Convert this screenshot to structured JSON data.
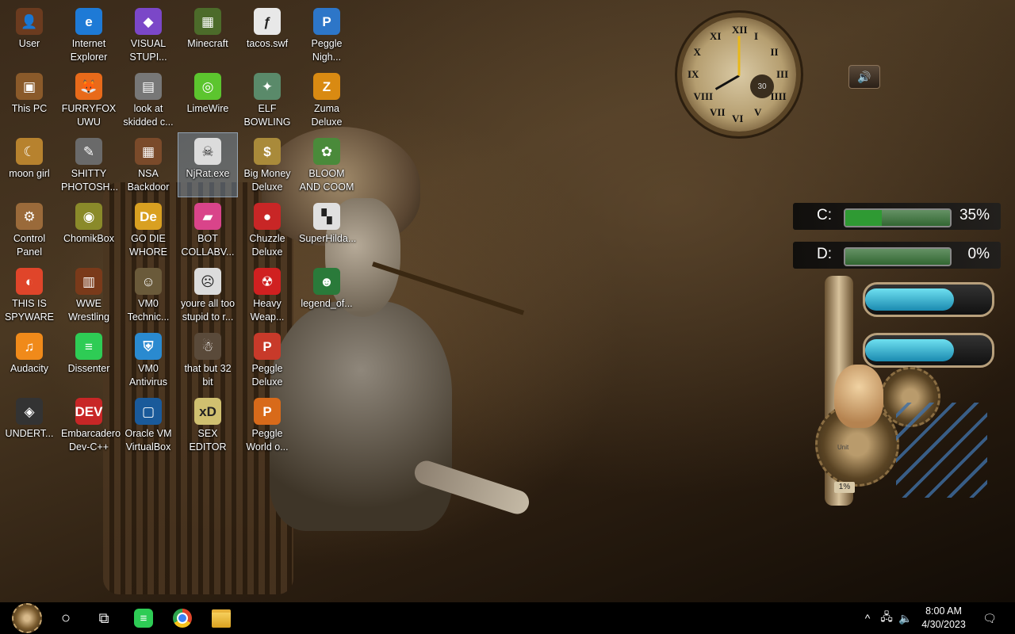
{
  "desktop": {
    "icons": [
      {
        "label": "User",
        "glyph": "👤",
        "color": "#6b3b1f",
        "col": 0,
        "row": 0
      },
      {
        "label": "Internet Explorer",
        "glyph": "e",
        "color": "#1e7ad6",
        "col": 1,
        "row": 0
      },
      {
        "label": "VISUAL STUPI...",
        "glyph": "◆",
        "color": "#7b47c8",
        "col": 2,
        "row": 0
      },
      {
        "label": "Minecraft",
        "glyph": "▦",
        "color": "#4c6b2a",
        "col": 3,
        "row": 0
      },
      {
        "label": "tacos.swf",
        "glyph": "ƒ",
        "color": "#e8e8e8",
        "col": 4,
        "row": 0
      },
      {
        "label": "Peggle Nigh...",
        "glyph": "P",
        "color": "#2d76c8",
        "col": 5,
        "row": 0
      },
      {
        "label": "This PC",
        "glyph": "▣",
        "color": "#8a5a2a",
        "col": 0,
        "row": 1
      },
      {
        "label": "FURRYFOX UWU",
        "glyph": "🦊",
        "color": "#e86a1a",
        "col": 1,
        "row": 1
      },
      {
        "label": "look at skidded c...",
        "glyph": "▤",
        "color": "#777777",
        "col": 2,
        "row": 1
      },
      {
        "label": "LimeWire",
        "glyph": "◎",
        "color": "#5cc52e",
        "col": 3,
        "row": 1
      },
      {
        "label": "ELF BOWLING",
        "glyph": "✦",
        "color": "#5a8a6a",
        "col": 4,
        "row": 1
      },
      {
        "label": "Zuma Deluxe",
        "glyph": "Z",
        "color": "#d98a12",
        "col": 5,
        "row": 1
      },
      {
        "label": "moon girl",
        "glyph": "☾",
        "color": "#b7822e",
        "col": 0,
        "row": 2
      },
      {
        "label": "SHITTY PHOTOSH...",
        "glyph": "✎",
        "color": "#6a6a6a",
        "col": 1,
        "row": 2
      },
      {
        "label": "NSA Backdoor",
        "glyph": "▦",
        "color": "#7a4a2a",
        "col": 2,
        "row": 2
      },
      {
        "label": "NjRat.exe",
        "glyph": "☠",
        "color": "#dcdcdc",
        "col": 3,
        "row": 2,
        "selected": true
      },
      {
        "label": "Big Money Deluxe",
        "glyph": "$",
        "color": "#a98a3a",
        "col": 4,
        "row": 2
      },
      {
        "label": "BLOOM AND COOM",
        "glyph": "✿",
        "color": "#4a8a3a",
        "col": 5,
        "row": 2
      },
      {
        "label": "Control Panel",
        "glyph": "⚙",
        "color": "#9a6a3a",
        "col": 0,
        "row": 3
      },
      {
        "label": "ChomikBox",
        "glyph": "◉",
        "color": "#8a8a2a",
        "col": 1,
        "row": 3
      },
      {
        "label": "GO DIE WHORE",
        "glyph": "De",
        "color": "#d9a021",
        "col": 2,
        "row": 3
      },
      {
        "label": "BOT COLLABV...",
        "glyph": "▰",
        "color": "#d9448a",
        "col": 3,
        "row": 3
      },
      {
        "label": "Chuzzle Deluxe",
        "glyph": "●",
        "color": "#c82626",
        "col": 4,
        "row": 3
      },
      {
        "label": "SuperHilda...",
        "glyph": "▚",
        "color": "#e0e0e0",
        "col": 5,
        "row": 3
      },
      {
        "label": "THIS IS SPYWARE",
        "glyph": "◐",
        "color": "#e0452a",
        "col": 0,
        "row": 4
      },
      {
        "label": "WWE Wrestling",
        "glyph": "▥",
        "color": "#7a3a1a",
        "col": 1,
        "row": 4
      },
      {
        "label": "VM0 Technic...",
        "glyph": "☺",
        "color": "#6a5a3a",
        "col": 2,
        "row": 4
      },
      {
        "label": "youre all too stupid to r...",
        "glyph": "☹",
        "color": "#dcdcdc",
        "col": 3,
        "row": 4
      },
      {
        "label": "Heavy Weap...",
        "glyph": "☢",
        "color": "#d02020",
        "col": 4,
        "row": 4
      },
      {
        "label": "legend_of...",
        "glyph": "☻",
        "color": "#2a7a3a",
        "col": 5,
        "row": 4
      },
      {
        "label": "Audacity",
        "glyph": "♫",
        "color": "#f08a1a",
        "col": 0,
        "row": 5
      },
      {
        "label": "Dissenter",
        "glyph": "≡",
        "color": "#2ecc55",
        "col": 1,
        "row": 5
      },
      {
        "label": "VM0 Antivirus",
        "glyph": "⛨",
        "color": "#2a8ad0",
        "col": 2,
        "row": 5
      },
      {
        "label": "that but 32 bit",
        "glyph": "☃",
        "color": "#5a4a3a",
        "col": 3,
        "row": 5
      },
      {
        "label": "Peggle Deluxe",
        "glyph": "P",
        "color": "#c83a2a",
        "col": 4,
        "row": 5
      },
      {
        "label": "UNDERT...",
        "glyph": "◈",
        "color": "#333333",
        "col": 0,
        "row": 6
      },
      {
        "label": "Embarcadero Dev-C++",
        "glyph": "DEV",
        "color": "#c82626",
        "col": 1,
        "row": 6
      },
      {
        "label": "Oracle VM VirtualBox",
        "glyph": "▢",
        "color": "#1a5a9a",
        "col": 2,
        "row": 6
      },
      {
        "label": "SEX EDITOR",
        "glyph": "xD",
        "color": "#d0c070",
        "col": 3,
        "row": 6
      },
      {
        "label": "Peggle World o...",
        "glyph": "P",
        "color": "#d86a1a",
        "col": 4,
        "row": 6
      }
    ]
  },
  "clock_gadget": {
    "numerals": [
      "XII",
      "I",
      "II",
      "III",
      "IIII",
      "V",
      "VI",
      "VII",
      "VIII",
      "IX",
      "X",
      "XI"
    ],
    "sub_dial": "30",
    "hour": 8,
    "minute": 0
  },
  "speaker_widget": {
    "icon": "speaker-icon",
    "glyph": "🔊"
  },
  "drives": [
    {
      "letter": "C:",
      "percent_text": "35%",
      "used_fraction": 0.35
    },
    {
      "letter": "D:",
      "percent_text": "0%",
      "used_fraction": 0.0
    }
  ],
  "pipe_meter": {
    "gauges": [
      0.7,
      0.7
    ],
    "unit_label": "Unit",
    "percent_text": "1%"
  },
  "taskbar": {
    "start": {
      "icon": "start-gear-icon"
    },
    "search": {
      "icon": "cortana-circle-icon",
      "glyph": "○"
    },
    "task_view": {
      "icon": "task-view-icon",
      "glyph": "⧉"
    },
    "pinned": [
      {
        "name": "dissenter",
        "glyph": "≡",
        "color": "#2ecc55"
      },
      {
        "name": "chrome",
        "glyph": "◐",
        "color": "#e0452a"
      },
      {
        "name": "file-explorer",
        "glyph": "▭",
        "color": "#e8b23a"
      }
    ],
    "tray": {
      "chevron": "^",
      "network": "🖧",
      "volume": "🔈",
      "time": "8:00 AM",
      "date": "4/30/2023",
      "notifications": "🗨"
    }
  }
}
